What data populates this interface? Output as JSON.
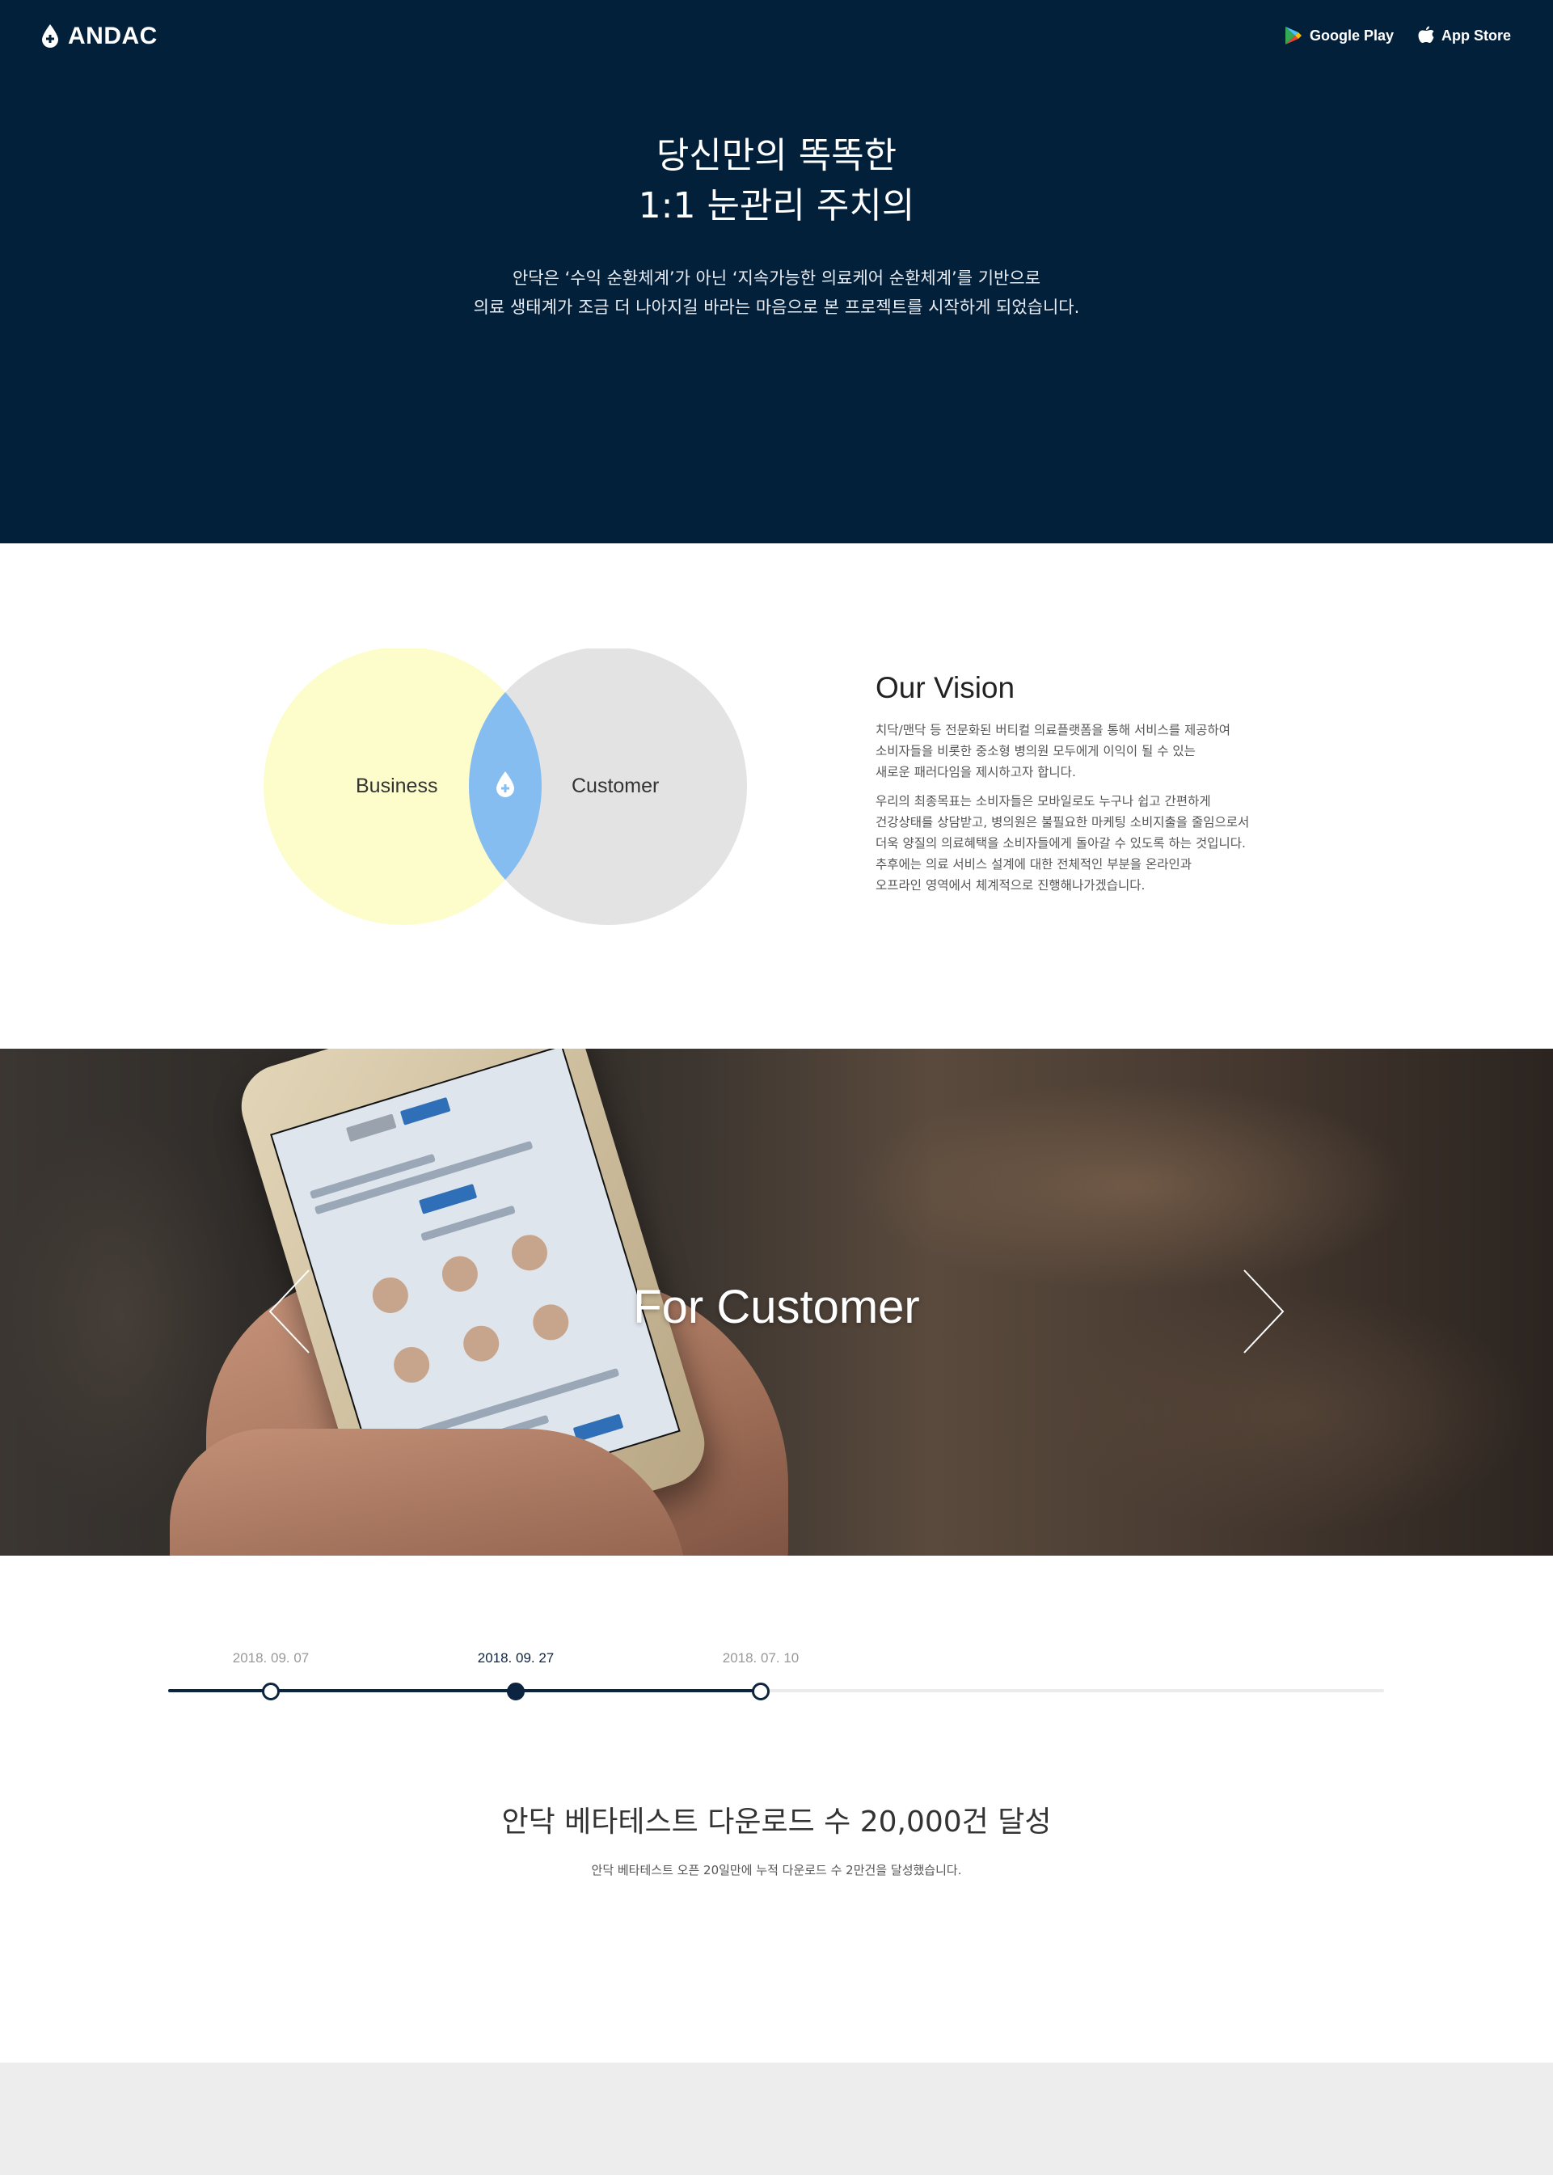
{
  "header": {
    "logo_text": "ANDAC",
    "stores": [
      {
        "label": "Google Play",
        "icon": "google-play-icon"
      },
      {
        "label": "App Store",
        "icon": "apple-icon"
      }
    ]
  },
  "hero": {
    "title_line1": "당신만의 똑똑한",
    "title_line2": "1:1 눈관리 주치의",
    "desc_line1": "안닥은 ‘수익 순환체계’가 아닌 ‘지속가능한 의료케어 순환체계’를 기반으로",
    "desc_line2": "의료 생태계가 조금 더 나아지길 바라는 마음으로 본 프로젝트를 시작하게 되었습니다."
  },
  "vision": {
    "venn_left": "Business",
    "venn_right": "Customer",
    "title": "Our Vision",
    "paragraph1": "치닥/맨닥 등 전문화된 버티컬 의료플랫폼을 통해 서비스를 제공하여\n소비자들을 비롯한 중소형 병의원 모두에게 이익이 될 수 있는\n새로운 패러다임을 제시하고자 합니다.",
    "paragraph2": "우리의 최종목표는 소비자들은 모바일로도 누구나 쉽고 간편하게\n건강상태를 상담받고, 병의원은 불필요한 마케팅 소비지출을 줄임으로서\n더욱 양질의 의료혜택을 소비자들에게 돌아갈 수 있도록 하는 것입니다.\n추후에는 의료 서비스 설계에 대한 전체적인 부분을 온라인과\n오프라인 영역에서 체계적으로 진행해나가겠습니다."
  },
  "carousel": {
    "slide_title": "For Customer"
  },
  "timeline": {
    "points": [
      {
        "date": "2018. 09. 07",
        "active": false
      },
      {
        "date": "2018. 09. 27",
        "active": true
      },
      {
        "date": "2018. 07. 10",
        "active": false
      }
    ]
  },
  "news": {
    "title": "안닥 베타테스트 다운로드 수 20,000건 달성",
    "desc": "안닥 베타테스트 오픈 20일만에 누적 다운로드 수 2만건을 달성했습니다."
  },
  "colors": {
    "navy": "#03203b",
    "venn_yellow": "#fdfdcc",
    "venn_gray": "#e3e3e3",
    "venn_blue": "#86bdf0",
    "footer": "#ededed"
  }
}
